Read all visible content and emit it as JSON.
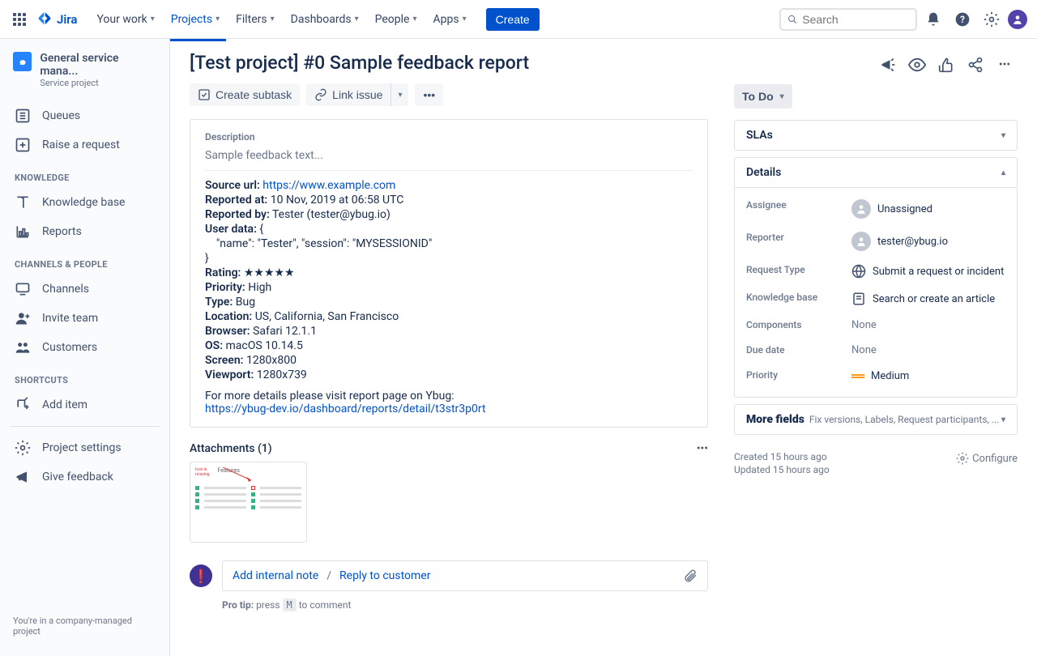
{
  "header": {
    "logo": "Jira",
    "nav": [
      "Your work",
      "Projects",
      "Filters",
      "Dashboards",
      "People",
      "Apps"
    ],
    "active_nav": 1,
    "create": "Create",
    "search_placeholder": "Search"
  },
  "sidebar": {
    "project_name": "General service mana...",
    "project_type": "Service project",
    "items_top": [
      {
        "label": "Queues",
        "icon": "queues"
      },
      {
        "label": "Raise a request",
        "icon": "raise"
      }
    ],
    "section_knowledge": "KNOWLEDGE",
    "items_knowledge": [
      {
        "label": "Knowledge base",
        "icon": "book"
      },
      {
        "label": "Reports",
        "icon": "chart"
      }
    ],
    "section_channels": "CHANNELS & PEOPLE",
    "items_channels": [
      {
        "label": "Channels",
        "icon": "monitor"
      },
      {
        "label": "Invite team",
        "icon": "adduser"
      },
      {
        "label": "Customers",
        "icon": "group"
      }
    ],
    "section_shortcuts": "SHORTCUTS",
    "items_shortcuts": [
      {
        "label": "Add item",
        "icon": "addlink"
      }
    ],
    "items_bottom": [
      {
        "label": "Project settings",
        "icon": "gear"
      },
      {
        "label": "Give feedback",
        "icon": "megaphone"
      }
    ],
    "footer": "You're in a company-managed project"
  },
  "issue": {
    "title": "[Test project] #0 Sample feedback report",
    "toolbar": {
      "create_subtask": "Create subtask",
      "link_issue": "Link issue"
    },
    "description": {
      "heading": "Description",
      "intro": "Sample feedback text...",
      "fields": {
        "source_url_label": "Source url:",
        "source_url": "https://www.example.com",
        "reported_at_label": "Reported at:",
        "reported_at": "10 Nov, 2019 at 06:58 UTC",
        "reported_by_label": "Reported by:",
        "reported_by": "Tester (tester@ybug.io)",
        "user_data_label": "User data:",
        "user_data_open": "{",
        "user_data_line": "    \"name\": \"Tester\", \"session\": \"MYSESSIONID\"",
        "user_data_close": "}",
        "rating_label": "Rating:",
        "rating": "★★★★★",
        "priority_label": "Priority:",
        "priority": "High",
        "type_label": "Type:",
        "type": "Bug",
        "location_label": "Location:",
        "location": "US, California, San Francisco",
        "browser_label": "Browser:",
        "browser": "Safari 12.1.1",
        "os_label": "OS:",
        "os": "macOS 10.14.5",
        "screen_label": "Screen:",
        "screen": "1280x800",
        "viewport_label": "Viewport:",
        "viewport": "1280x739"
      },
      "footer_text": "For more details please visit report page on Ybug:",
      "footer_link": "https://ybug-dev.io/dashboard/reports/detail/t3str3p0rt"
    },
    "attachments": {
      "title": "Attachments (1)"
    },
    "reply": {
      "internal": "Add internal note",
      "customer": "Reply to customer",
      "protip_label": "Pro tip:",
      "protip_pre": "press",
      "protip_key": "M",
      "protip_post": "to comment"
    }
  },
  "side": {
    "status": "To Do",
    "slas": "SLAs",
    "details": {
      "heading": "Details",
      "assignee_label": "Assignee",
      "assignee": "Unassigned",
      "reporter_label": "Reporter",
      "reporter": "tester@ybug.io",
      "request_type_label": "Request Type",
      "request_type": "Submit a request or incident",
      "kb_label": "Knowledge base",
      "kb": "Search or create an article",
      "components_label": "Components",
      "components": "None",
      "due_label": "Due date",
      "due": "None",
      "priority_label": "Priority",
      "priority": "Medium"
    },
    "more_fields": "More fields",
    "more_fields_sub": "Fix versions, Labels, Request participants, ...",
    "created": "Created 15 hours ago",
    "updated": "Updated 15 hours ago",
    "configure": "Configure"
  }
}
